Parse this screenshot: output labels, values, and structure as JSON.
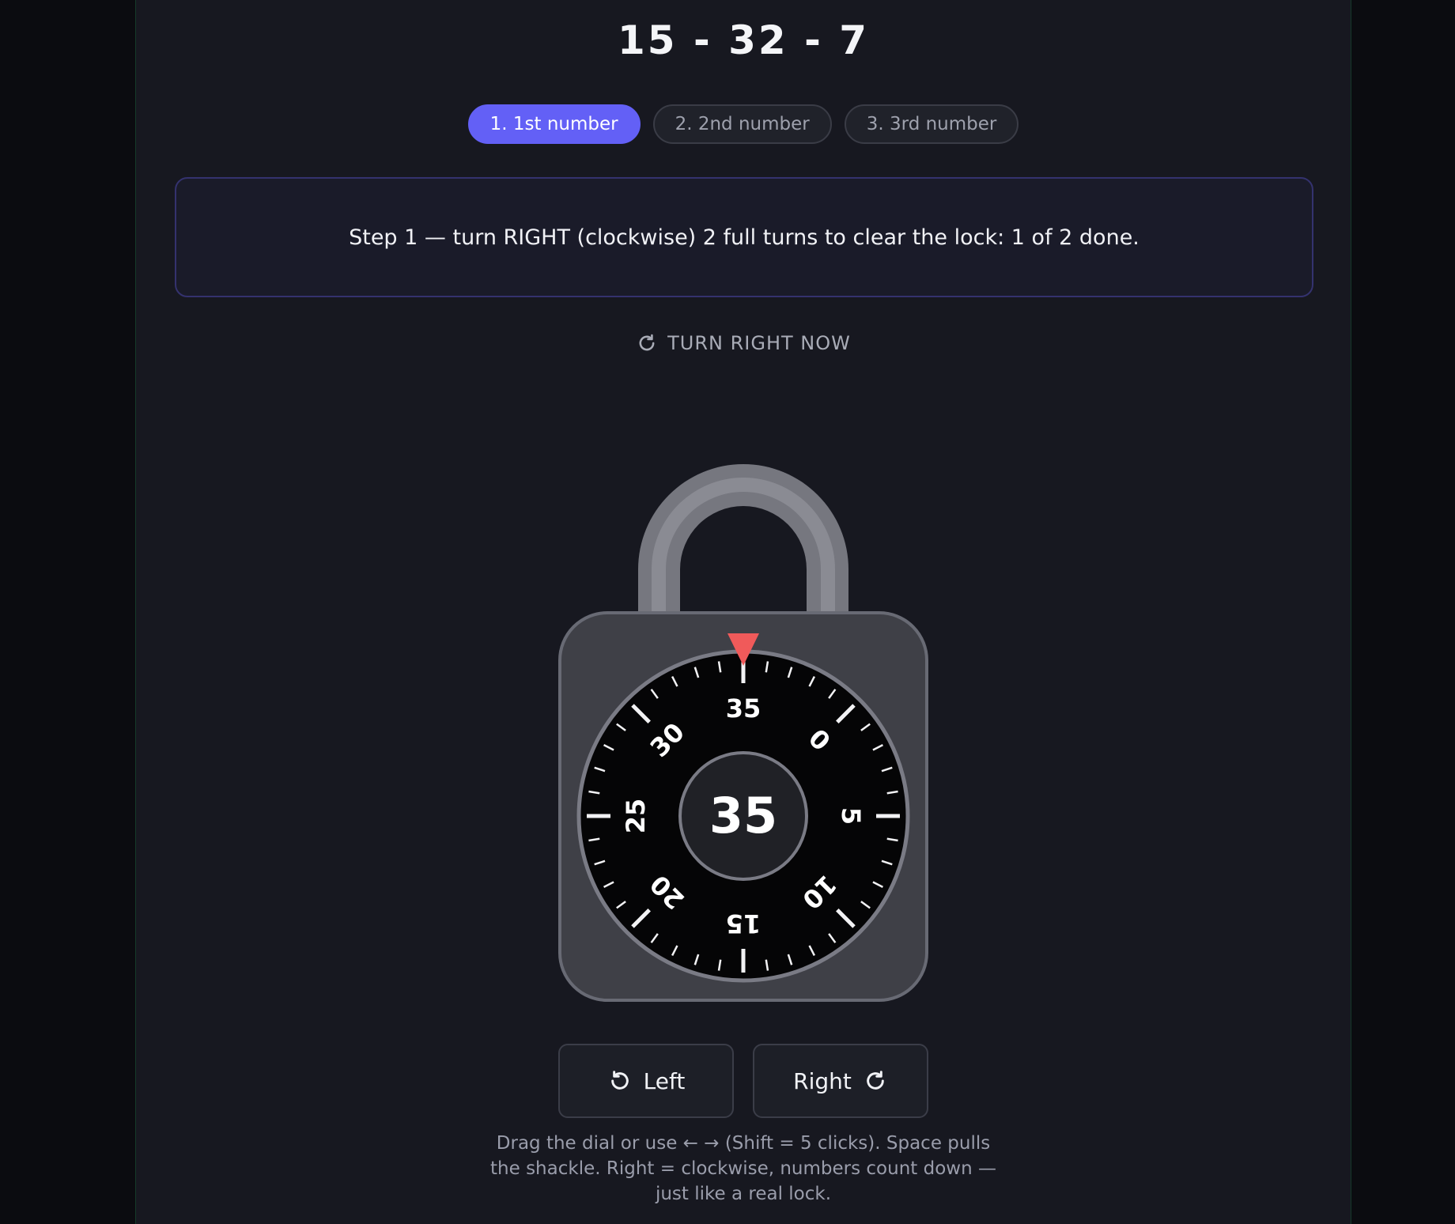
{
  "combination": "15 - 32 - 7",
  "steps": [
    {
      "label": "1. 1st number",
      "active": true
    },
    {
      "label": "2. 2nd number",
      "active": false
    },
    {
      "label": "3. 3rd number",
      "active": false
    }
  ],
  "instruction": "Step 1 — turn RIGHT (clockwise) 2 full turns to clear the lock: 1 of 2 done.",
  "turn_prompt": "TURN RIGHT NOW",
  "dial": {
    "current_value": "35",
    "range_max": 39,
    "major_labels": [
      "0",
      "5",
      "10",
      "15",
      "20",
      "25",
      "30",
      "35"
    ],
    "indicator_color": "#f05a5a"
  },
  "buttons": {
    "left_label": "Left",
    "right_label": "Right"
  },
  "hint": "Drag the dial or use ← → (Shift = 5 clicks). Space pulls the shackle. Right = clockwise, numbers count down — just like a real lock.",
  "colors": {
    "accent": "#6360f6",
    "background": "#171820",
    "lock_body": "#3f4047",
    "shackle": "#76777f"
  }
}
